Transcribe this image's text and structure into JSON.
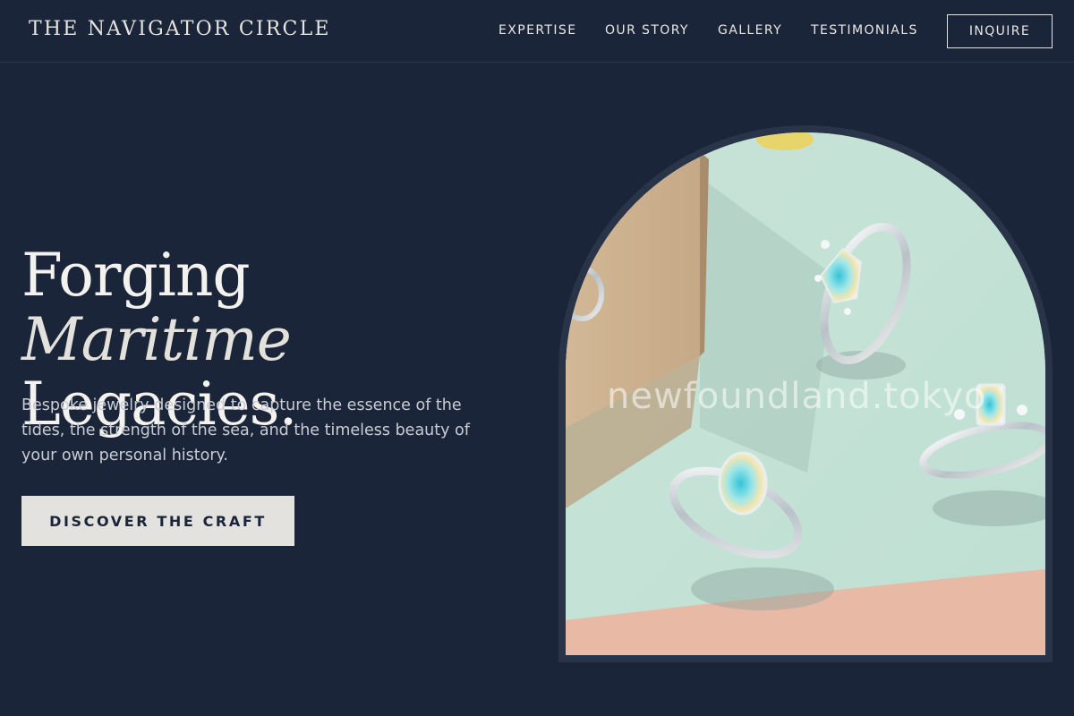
{
  "header": {
    "logo": "THE NAVIGATOR CIRCLE",
    "nav": [
      "EXPERTISE",
      "OUR STORY",
      "GALLERY",
      "TESTIMONIALS"
    ],
    "inquire_label": "INQUIRE"
  },
  "hero": {
    "title_part1": "Forging ",
    "title_accent": "Maritime",
    "title_part2": "Legacies.",
    "description": "Bespoke jewelry designed to capture the essence of the tides, the strength of the sea, and the timeless beauty of your own personal history.",
    "cta_label": "DISCOVER THE CRAFT"
  },
  "image": {
    "watermark": "newfoundland.tokyo"
  },
  "colors": {
    "background": "#1b2539",
    "frame": "#2a3448",
    "text": "#e8e6e1",
    "button_bg": "#e3e2df"
  }
}
